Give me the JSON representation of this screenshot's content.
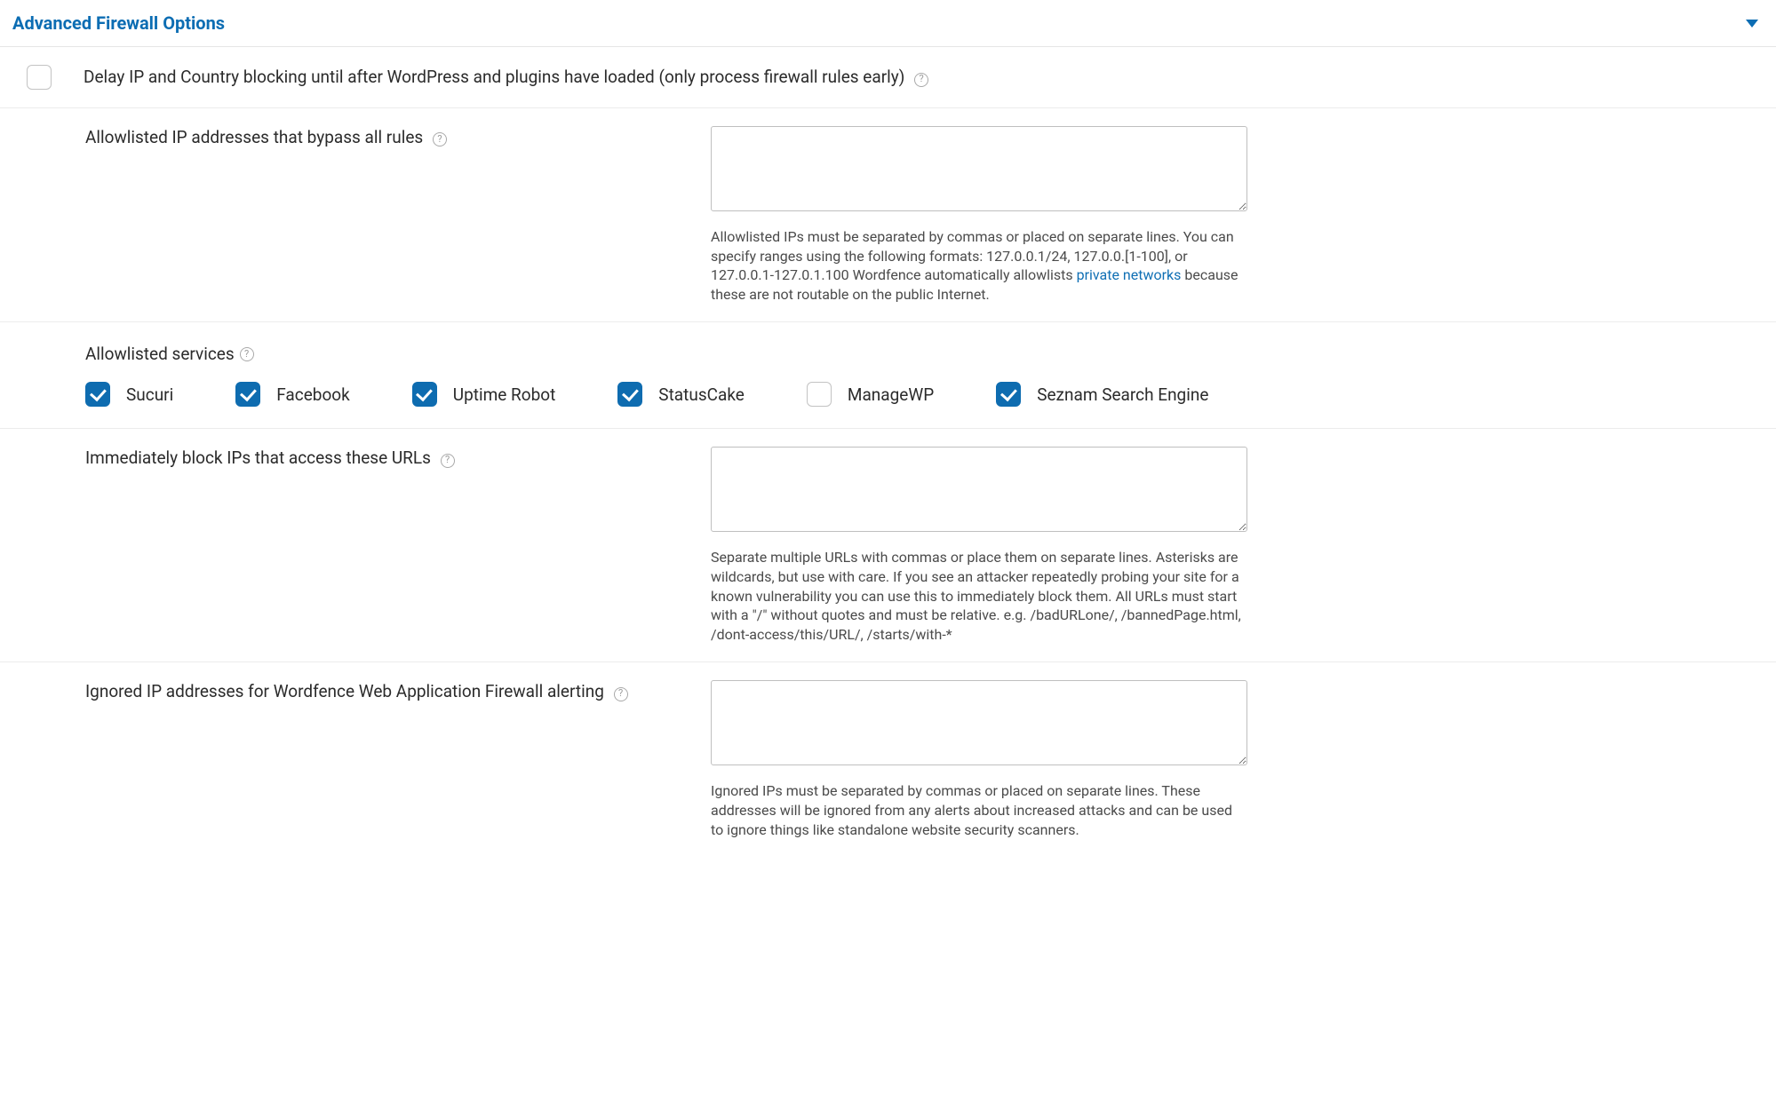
{
  "header": {
    "title": "Advanced Firewall Options"
  },
  "rows": {
    "delay_blocking": {
      "label": "Delay IP and Country blocking until after WordPress and plugins have loaded (only process firewall rules early)",
      "checked": false
    },
    "allowlist_ips": {
      "label": "Allowlisted IP addresses that bypass all rules",
      "value": "",
      "hint_pre": "Allowlisted IPs must be separated by commas or placed on separate lines. You can specify ranges using the following formats: 127.0.0.1/24, 127.0.0.[1-100], or 127.0.0.1-127.0.1.100 Wordfence automatically allowlists ",
      "hint_link": "private networks",
      "hint_post": " because these are not routable on the public Internet."
    },
    "allowlisted_services": {
      "label": "Allowlisted services",
      "items": [
        {
          "name": "Sucuri",
          "checked": true
        },
        {
          "name": "Facebook",
          "checked": true
        },
        {
          "name": "Uptime Robot",
          "checked": true
        },
        {
          "name": "StatusCake",
          "checked": true
        },
        {
          "name": "ManageWP",
          "checked": false
        },
        {
          "name": "Seznam Search Engine",
          "checked": true
        }
      ]
    },
    "block_urls": {
      "label": "Immediately block IPs that access these URLs",
      "value": "",
      "hint": "Separate multiple URLs with commas or place them on separate lines. Asterisks are wildcards, but use with care. If you see an attacker repeatedly probing your site for a known vulnerability you can use this to immediately block them. All URLs must start with a \"/\" without quotes and must be relative. e.g. /badURLone/, /bannedPage.html, /dont-access/this/URL/, /starts/with-*"
    },
    "ignored_ips": {
      "label": "Ignored IP addresses for Wordfence Web Application Firewall alerting",
      "value": "",
      "hint": "Ignored IPs must be separated by commas or placed on separate lines. These addresses will be ignored from any alerts about increased attacks and can be used to ignore things like standalone website security scanners."
    }
  }
}
